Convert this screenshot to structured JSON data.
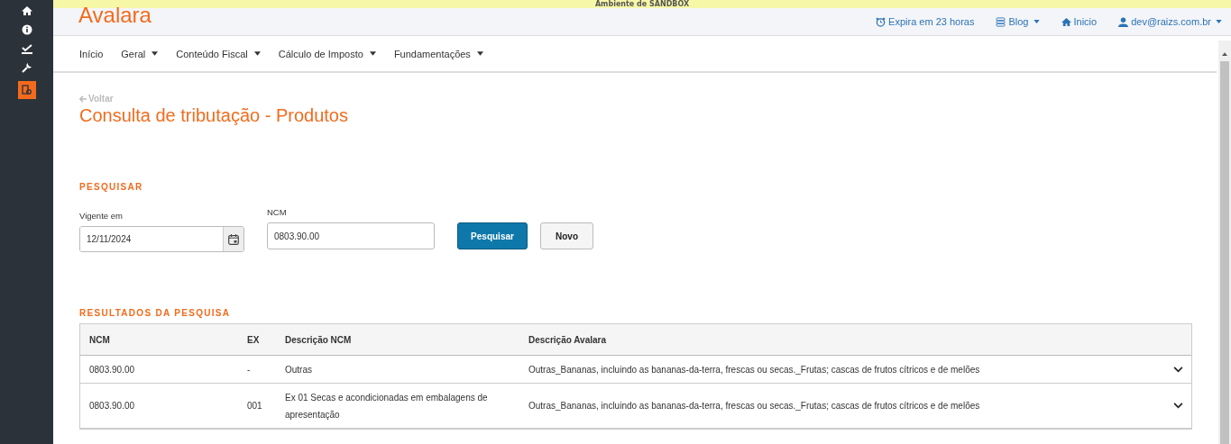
{
  "banner": {
    "text": "Ambiente de SANDBOX"
  },
  "sidebar": {
    "items": [
      {
        "kind": "home",
        "selected": false
      },
      {
        "kind": "info",
        "selected": false
      },
      {
        "kind": "check",
        "selected": false
      },
      {
        "kind": "wrench",
        "selected": false
      },
      {
        "kind": "tax",
        "selected": true
      }
    ]
  },
  "header": {
    "logo": "Avalara",
    "links": [
      {
        "kind": "clock",
        "label": "Expira em 23 horas",
        "dropdown": false
      },
      {
        "kind": "blog",
        "label": "Blog",
        "dropdown": true
      },
      {
        "kind": "home",
        "label": "Inicio",
        "dropdown": false
      },
      {
        "kind": "user",
        "label": "dev@raizs.com.br",
        "dropdown": true
      }
    ]
  },
  "nav": {
    "items": [
      {
        "label": "Início",
        "dropdown": false
      },
      {
        "label": "Geral",
        "dropdown": true
      },
      {
        "label": "Conteúdo Fiscal",
        "dropdown": true
      },
      {
        "label": "Cálculo de Imposto",
        "dropdown": true
      },
      {
        "label": "Fundamentações",
        "dropdown": true
      }
    ]
  },
  "back_link": "Voltar",
  "title": "Consulta de tributação - Produtos",
  "search": {
    "heading": "PESQUISAR",
    "date_label": "Vigente em",
    "date_value": "12/11/2024",
    "ncm_label": "NCM",
    "ncm_value": "0803.90.00",
    "buttons": [
      {
        "kind": "primary",
        "label": "Pesquisar"
      },
      {
        "kind": "default",
        "label": "Novo"
      }
    ]
  },
  "results": {
    "heading": "RESULTADOS DA PESQUISA",
    "columns": [
      "NCM",
      "EX",
      "Descrição NCM",
      "Descrição Avalara"
    ],
    "rows": [
      {
        "cells": [
          "0803.90.00",
          "-",
          "Outras",
          "Outras_Bananas, incluindo as bananas-da-terra, frescas ou secas._Frutas; cascas de frutos cítricos e de melões"
        ],
        "expanded": false
      },
      {
        "cells": [
          "0803.90.00",
          "001",
          "Ex 01 Secas e acondicionadas em embalagens de apresentação",
          "Outras_Bananas, incluindo as bananas-da-terra, frescas ou secas._Frutas; cascas de frutos cítricos e de melões"
        ],
        "expanded": false
      }
    ]
  }
}
